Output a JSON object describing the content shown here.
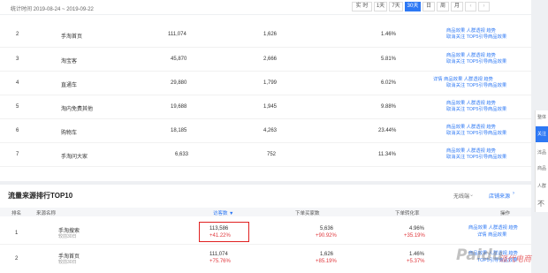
{
  "header": {
    "date_label": "统计时间 2019-08-24 ~ 2019-09-22",
    "ranges": [
      "实 时",
      "1天",
      "7天",
      "30天",
      "日",
      "周",
      "月",
      "‹",
      "›"
    ],
    "active_range_index": 3
  },
  "top_rows": [
    {
      "rank": "2",
      "name": "手淘首页",
      "v1": "111,074",
      "v2": "1,626",
      "v3": "1.46%",
      "links_line1": "商品效果  人群透视  趋势",
      "links_line2": "取消关注  TOP5引导商品效果"
    },
    {
      "rank": "3",
      "name": "淘宝客",
      "v1": "45,870",
      "v2": "2,666",
      "v3": "5.81%",
      "links_line1": "商品效果  人群透视  趋势",
      "links_line2": "取消关注  TOP5引导商品效果"
    },
    {
      "rank": "4",
      "name": "直通车",
      "v1": "29,880",
      "v2": "1,799",
      "v3": "6.02%",
      "links_line1": "详情  商品效果  人群透视  趋势",
      "links_line2": "取消关注  TOP5引导商品效果"
    },
    {
      "rank": "5",
      "name": "淘内免费其他",
      "v1": "19,688",
      "v2": "1,945",
      "v3": "9.88%",
      "links_line1": "商品效果  人群透视  趋势",
      "links_line2": "取消关注  TOP5引导商品效果"
    },
    {
      "rank": "6",
      "name": "购物车",
      "v1": "18,185",
      "v2": "4,263",
      "v3": "23.44%",
      "links_line1": "商品效果  人群透视  趋势",
      "links_line2": "取消关注  TOP5引导商品效果"
    },
    {
      "rank": "7",
      "name": "手淘问大家",
      "v1": "6,633",
      "v2": "752",
      "v3": "11.34%",
      "links_line1": "商品效果  人群透视  趋势",
      "links_line2": "取消关注  TOP5引导商品效果"
    }
  ],
  "section": {
    "title": "流量来源排行TOP10",
    "wireless": "无线端",
    "store_source": "店铺来源",
    "columns": [
      "排名",
      "来源名称",
      "访客数 ▼",
      "下单买家数",
      "下单转化率",
      "操作"
    ]
  },
  "bottom_rows": [
    {
      "rank": "1",
      "name": "手淘搜索",
      "sub": "较前30日",
      "v1": "113,586",
      "v1c": "+41.22%",
      "v2": "5,636",
      "v2c": "+90.92%",
      "v3": "4.96%",
      "v3c": "+35.19%",
      "links_line1": "商品效果  人群透视  趋势",
      "links_line2": "详情  商品效果"
    },
    {
      "rank": "2",
      "name": "手淘首页",
      "sub": "较前30日",
      "v1": "111,074",
      "v1c": "+75.76%",
      "v2": "1,626",
      "v2c": "+85.19%",
      "v3": "1.46%",
      "v3c": "+5.37%",
      "links_line1": "商品效果  人群透视  趋势",
      "links_line2": "TOP5引导商品效果"
    }
  ],
  "right_panel": [
    "整体",
    "关注",
    "淬品",
    "商品",
    "人群",
    "不"
  ],
  "watermark": {
    "text1": "Paidu",
    "text2": "派代电商"
  },
  "colors": {
    "accent": "#2d78f4",
    "positive": "#e0393e",
    "highlight_box": "#e02020"
  }
}
